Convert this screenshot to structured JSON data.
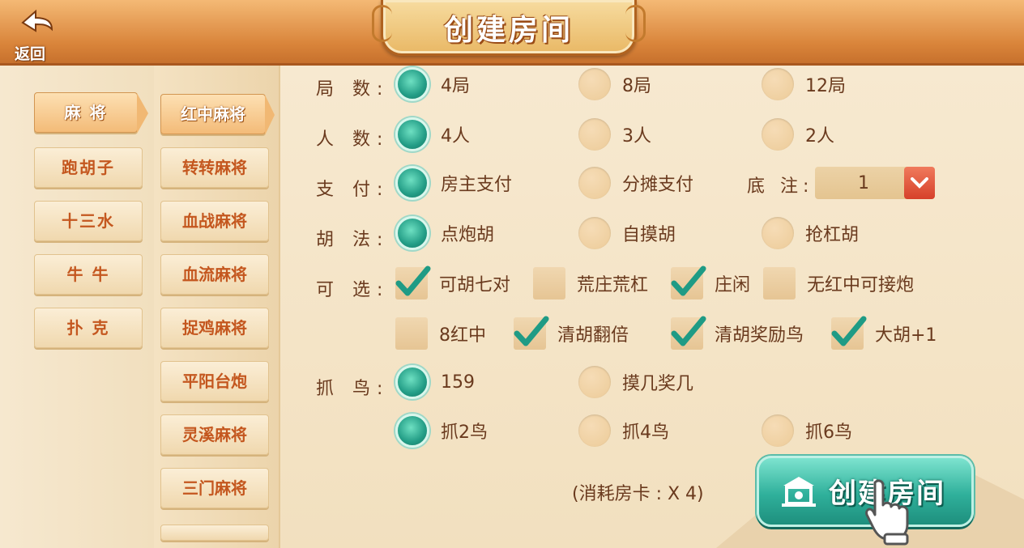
{
  "header": {
    "back_label": "返回",
    "title": "创建房间"
  },
  "categories": [
    {
      "label": "麻 将",
      "selected": true
    },
    {
      "label": "跑胡子",
      "selected": false
    },
    {
      "label": "十三水",
      "selected": false
    },
    {
      "label": "牛 牛",
      "selected": false
    },
    {
      "label": "扑 克",
      "selected": false
    }
  ],
  "games": [
    {
      "label": "红中麻将",
      "selected": true
    },
    {
      "label": "转转麻将",
      "selected": false
    },
    {
      "label": "血战麻将",
      "selected": false
    },
    {
      "label": "血流麻将",
      "selected": false
    },
    {
      "label": "捉鸡麻将",
      "selected": false
    },
    {
      "label": "平阳台炮",
      "selected": false
    },
    {
      "label": "灵溪麻将",
      "selected": false
    },
    {
      "label": "三门麻将",
      "selected": false
    },
    {
      "label": "",
      "selected": false
    }
  ],
  "options": {
    "rounds": {
      "label": "局 数:",
      "choices": [
        {
          "label": "4局",
          "checked": true
        },
        {
          "label": "8局",
          "checked": false
        },
        {
          "label": "12局",
          "checked": false
        }
      ]
    },
    "players": {
      "label": "人 数:",
      "choices": [
        {
          "label": "4人",
          "checked": true
        },
        {
          "label": "3人",
          "checked": false
        },
        {
          "label": "2人",
          "checked": false
        }
      ]
    },
    "payment": {
      "label": "支 付:",
      "choices": [
        {
          "label": "房主支付",
          "checked": true
        },
        {
          "label": "分摊支付",
          "checked": false
        }
      ]
    },
    "base_bet": {
      "label": "底 注:",
      "value": "1"
    },
    "win_method": {
      "label": "胡 法:",
      "choices": [
        {
          "label": "点炮胡",
          "checked": true
        },
        {
          "label": "自摸胡",
          "checked": false
        },
        {
          "label": "抢杠胡",
          "checked": false
        }
      ]
    },
    "optional": {
      "label": "可 选:",
      "choices": [
        {
          "label": "可胡七对",
          "checked": true
        },
        {
          "label": "荒庄荒杠",
          "checked": false
        },
        {
          "label": "庄闲",
          "checked": true
        },
        {
          "label": "无红中可接炮",
          "checked": false
        },
        {
          "label": "8红中",
          "checked": false
        },
        {
          "label": "清胡翻倍",
          "checked": true
        },
        {
          "label": "清胡奖励鸟",
          "checked": true
        },
        {
          "label": "大胡+1",
          "checked": true
        }
      ]
    },
    "birds": {
      "label": "抓 鸟:",
      "choices": [
        {
          "label": "159",
          "checked": true
        },
        {
          "label": "摸几奖几",
          "checked": false
        },
        {
          "label": "抓2鸟",
          "checked": true
        },
        {
          "label": "抓4鸟",
          "checked": false
        },
        {
          "label": "抓6鸟",
          "checked": false
        }
      ]
    }
  },
  "footer": {
    "cost_text": "(消耗房卡 : X 4)",
    "create_label": "创建房间"
  },
  "colors": {
    "accent": "#2fb09b",
    "header": "#d9843a",
    "text": "#6a3a1e",
    "tab_text": "#c4571f"
  }
}
